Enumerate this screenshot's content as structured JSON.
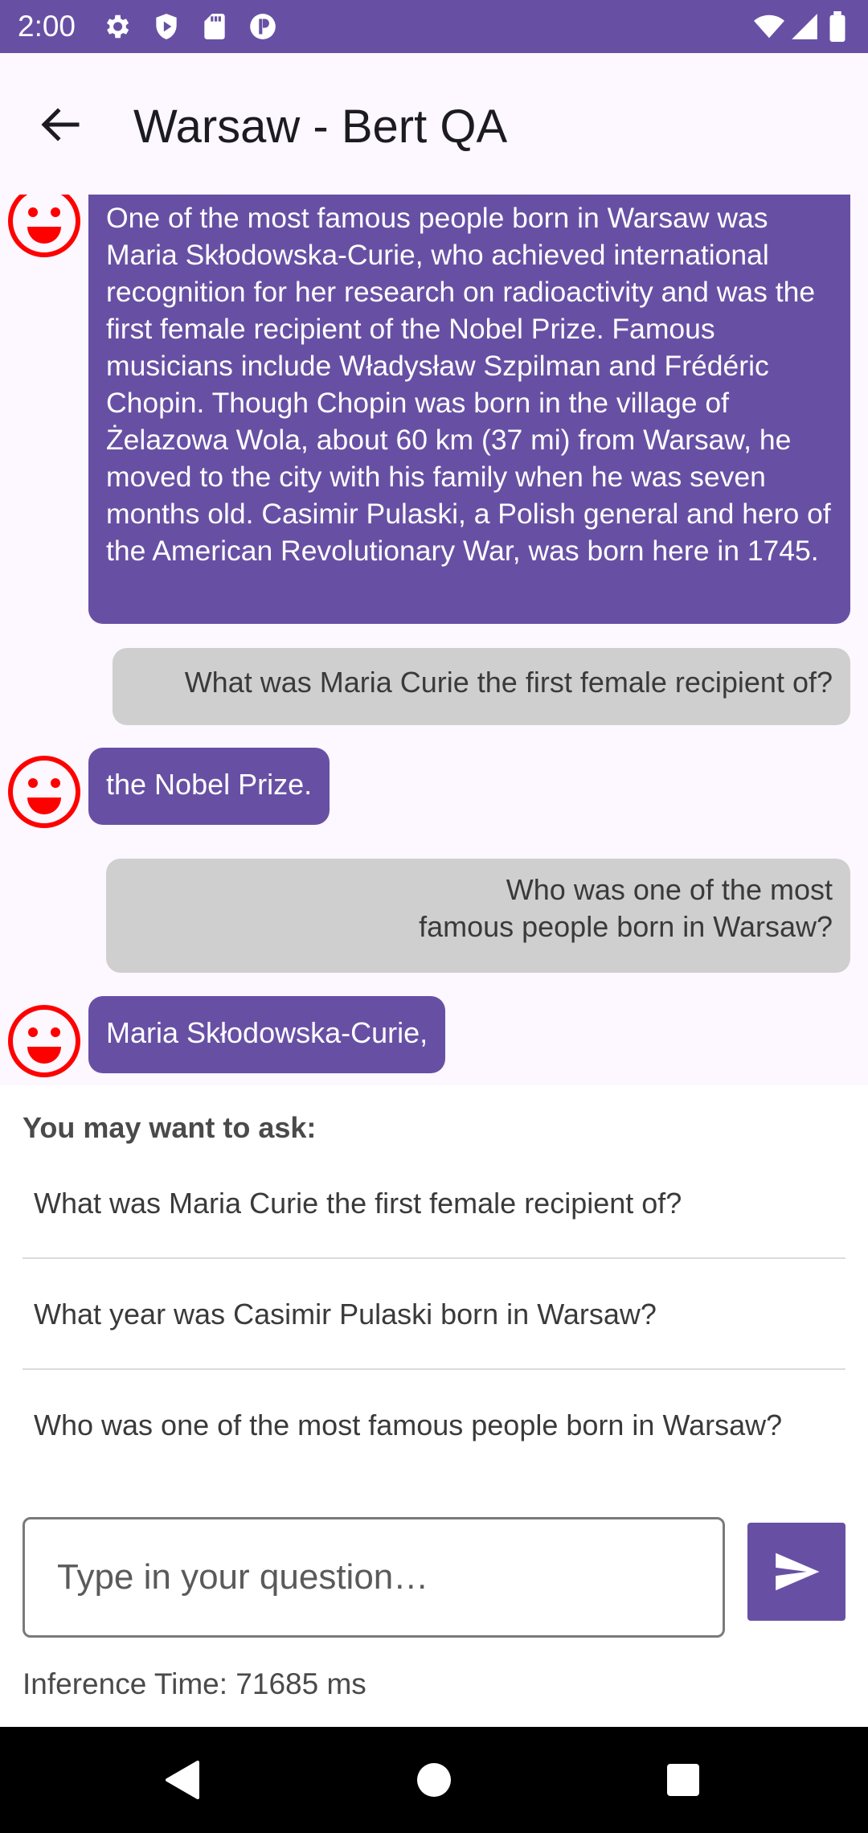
{
  "status_bar": {
    "time": "2:00",
    "left_icons": [
      "gear-icon",
      "shield-play-icon",
      "sd-card-icon",
      "pocket-app-icon"
    ],
    "right_icons": [
      "wifi-icon",
      "signal-icon",
      "battery-icon"
    ]
  },
  "app_bar": {
    "title": "Warsaw - Bert QA",
    "back_icon": "arrow-back-icon"
  },
  "chat": {
    "messages": [
      {
        "sender": "bot",
        "text": "One of the most famous people born in Warsaw was Maria Skłodowska-Curie, who achieved international recognition for her research on radioactivity and was the first female recipient of the Nobel Prize. Famous musicians include Władysław Szpilman and Frédéric Chopin. Though Chopin was born in the village of Żelazowa Wola, about 60 km (37 mi) from Warsaw, he moved to the city with his family when he was seven months old. Casimir Pulaski, a Polish general and hero of the American Revolutionary War, was born here in 1745."
      },
      {
        "sender": "user",
        "text": "What was Maria Curie the first female recipient of?"
      },
      {
        "sender": "bot",
        "text": "the Nobel Prize."
      },
      {
        "sender": "user",
        "text": "Who was one of the most\nfamous people born in Warsaw?"
      },
      {
        "sender": "bot",
        "text": "Maria Skłodowska-Curie,"
      }
    ]
  },
  "suggestions": {
    "header": "You may want to ask:",
    "items": [
      "What was Maria Curie the first female recipient of?",
      "What year was Casimir Pulaski born in Warsaw?",
      "Who was one of the most famous people born in Warsaw?"
    ]
  },
  "input": {
    "placeholder": "Type in your question…",
    "value": ""
  },
  "send_icon": "send-icon",
  "inference": {
    "label": "Inference Time: 71685 ms"
  },
  "nav_bar": {
    "icons": [
      "nav-back-icon",
      "nav-home-icon",
      "nav-recents-icon"
    ]
  },
  "colors": {
    "primary": "#6750a4",
    "chat_background": "#fdf7ff",
    "user_bubble": "#cfcfcf",
    "avatar": "#ff0000"
  }
}
